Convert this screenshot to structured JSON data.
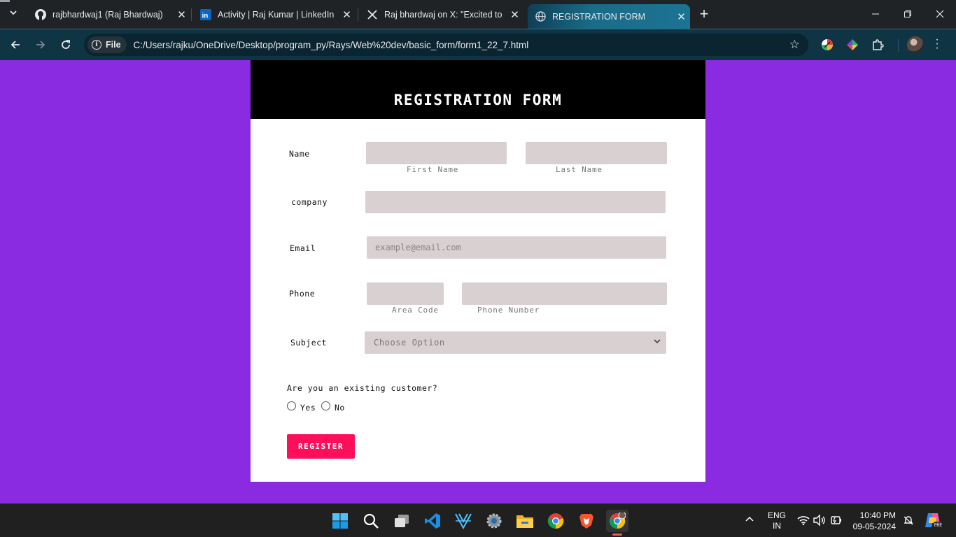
{
  "browser": {
    "tabs": [
      {
        "title": "rajbhardwaj1 (Raj Bhardwaj)",
        "icon": "github-icon"
      },
      {
        "title": "Activity | Raj Kumar | LinkedIn",
        "icon": "linkedin-icon"
      },
      {
        "title": "Raj bhardwaj on X: \"Excited to s",
        "icon": "x-icon"
      },
      {
        "title": "REGISTRATION FORM",
        "icon": "globe-icon",
        "active": true
      }
    ],
    "site_chip": "File",
    "url": "C:/Users/rajku/OneDrive/Desktop/program_py/Rays/Web%20dev/basic_form/form1_22_7.html"
  },
  "form": {
    "title": "REGISTRATION FORM",
    "name_label": "Name",
    "first_name_hint": "First Name",
    "last_name_hint": "Last Name",
    "company_label": "company",
    "email_label": "Email",
    "email_placeholder": "example@email.com",
    "phone_label": "Phone",
    "area_code_hint": "Area Code",
    "phone_number_hint": "Phone Number",
    "subject_label": "Subject",
    "subject_selected": "Choose Option",
    "customer_question": "Are you an existing customer?",
    "yes_label": "Yes",
    "no_label": "No",
    "register_label": "REGISTER"
  },
  "colors": {
    "page_background": "#8a2be2",
    "header_background": "#000000",
    "input_background": "#d9d1d1",
    "register_button": "#ff0f5b"
  },
  "taskbar": {
    "language": "ENG",
    "region": "IN",
    "time": "10:40 PM",
    "date": "09-05-2024",
    "apps": [
      "windows-start-icon",
      "search-icon",
      "task-view-icon",
      "vscode-icon",
      "winsurf-icon",
      "settings-icon",
      "file-explorer-icon",
      "chrome-icon",
      "brave-icon",
      "chrome-profile-icon"
    ]
  }
}
